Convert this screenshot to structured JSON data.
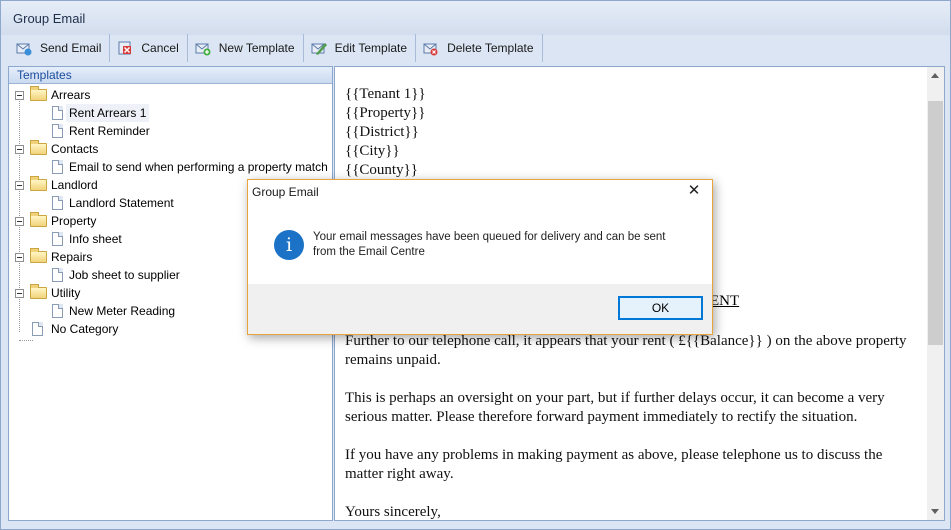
{
  "window": {
    "title": "Group Email"
  },
  "toolbar": {
    "buttons": [
      {
        "label": "Send Email",
        "icon": "send-email-icon"
      },
      {
        "label": "Cancel",
        "icon": "cancel-icon"
      },
      {
        "label": "New Template",
        "icon": "new-template-icon"
      },
      {
        "label": "Edit Template",
        "icon": "edit-template-icon"
      },
      {
        "label": "Delete Template",
        "icon": "delete-template-icon"
      }
    ]
  },
  "templates": {
    "header": "Templates",
    "tree": [
      {
        "label": "Arrears",
        "children": [
          "Rent Arrears 1",
          "Rent Reminder"
        ]
      },
      {
        "label": "Contacts",
        "children": [
          "Email to send when performing a property match"
        ]
      },
      {
        "label": "Landlord",
        "children": [
          "Landlord Statement"
        ]
      },
      {
        "label": "Property",
        "children": [
          "Info sheet"
        ]
      },
      {
        "label": "Repairs",
        "children": [
          "Job sheet to supplier"
        ]
      },
      {
        "label": "Utility",
        "children": [
          "New Meter Reading"
        ]
      }
    ],
    "uncategorized": "No Category",
    "selected": "Rent Arrears 1"
  },
  "document": {
    "lines": [
      "{{Tenant 1}}",
      "{{Property}}",
      "{{District}}",
      "{{City}}",
      "{{County}}"
    ],
    "heading_fragment": "ENT",
    "paragraphs": [
      "Further to our telephone call, it appears that your rent ( £{{Balance}} ) on the above property remains unpaid.",
      "This is perhaps an oversight on your part, but if further delays occur, it can become a very serious matter. Please therefore forward payment immediately to rectify the situation.",
      "If you have any problems in making payment as above, please telephone us to discuss the matter right away.",
      "Yours sincerely,"
    ]
  },
  "dialog": {
    "title": "Group Email",
    "message_line1": "Your email messages have been queued for delivery and can be sent",
    "message_line2": "from the Email Centre",
    "ok_label": "OK",
    "icon": "info-icon"
  },
  "colors": {
    "accent": "#1b72c6",
    "dialog_border": "#e8a33d",
    "tree_header": "#1a4c9c"
  }
}
